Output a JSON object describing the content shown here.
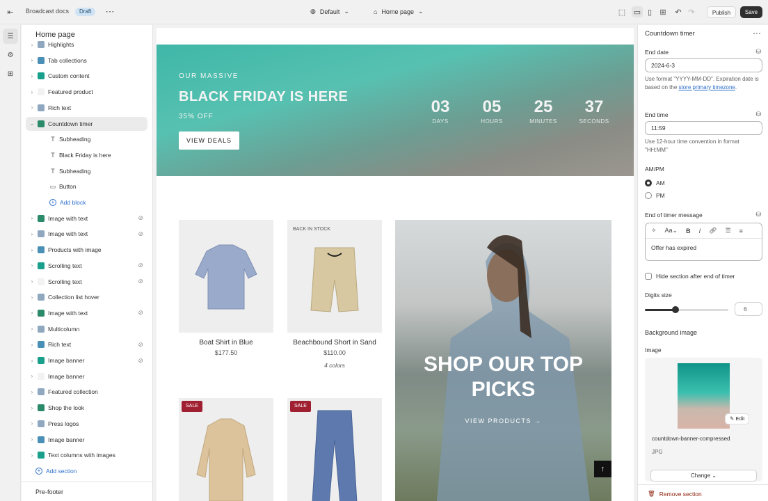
{
  "topbar": {
    "store_name": "Broadcast docs",
    "status_badge": "Draft",
    "theme_select": "Default",
    "page_select": "Home page",
    "publish_label": "Publish",
    "save_label": "Save"
  },
  "sidebar": {
    "title": "Home page",
    "items": [
      {
        "label": "Highlights",
        "level": 0,
        "icon": "section-icon"
      },
      {
        "label": "Tab collections",
        "level": 0,
        "icon": "section-icon"
      },
      {
        "label": "Custom content",
        "level": 0,
        "icon": "section-icon"
      },
      {
        "label": "Featured product",
        "level": 0,
        "icon": "section-icon"
      },
      {
        "label": "Rich text",
        "level": 0,
        "icon": "section-icon"
      },
      {
        "label": "Countdown timer",
        "level": 0,
        "icon": "section-icon"
      },
      {
        "label": "Subheading",
        "level": 1,
        "icon": "text-icon"
      },
      {
        "label": "Black Friday is here",
        "level": 1,
        "icon": "text-icon"
      },
      {
        "label": "Subheading",
        "level": 1,
        "icon": "text-icon"
      },
      {
        "label": "Button",
        "level": 1,
        "icon": "button-icon"
      },
      {
        "label": "Add block",
        "level": 1,
        "icon": "add-icon"
      },
      {
        "label": "Image with text",
        "level": 0,
        "icon": "section-icon"
      },
      {
        "label": "Image with text",
        "level": 0,
        "icon": "section-icon"
      },
      {
        "label": "Products with image",
        "level": 0,
        "icon": "section-icon"
      },
      {
        "label": "Scrolling text",
        "level": 0,
        "icon": "section-icon"
      },
      {
        "label": "Scrolling text",
        "level": 0,
        "icon": "section-icon"
      },
      {
        "label": "Collection list hover",
        "level": 0,
        "icon": "section-icon"
      },
      {
        "label": "Image with text",
        "level": 0,
        "icon": "section-icon"
      },
      {
        "label": "Multicolumn",
        "level": 0,
        "icon": "section-icon"
      },
      {
        "label": "Rich text",
        "level": 0,
        "icon": "section-icon"
      },
      {
        "label": "Image banner",
        "level": 0,
        "icon": "section-icon"
      },
      {
        "label": "Image banner",
        "level": 0,
        "icon": "section-icon"
      },
      {
        "label": "Featured collection",
        "level": 0,
        "icon": "section-icon"
      },
      {
        "label": "Shop the look",
        "level": 0,
        "icon": "section-icon"
      },
      {
        "label": "Press logos",
        "level": 0,
        "icon": "section-icon"
      },
      {
        "label": "Image banner",
        "level": 0,
        "icon": "section-icon"
      },
      {
        "label": "Text columns with images",
        "level": 0,
        "icon": "section-icon"
      },
      {
        "label": "Add section",
        "level": 0,
        "icon": "add-icon"
      }
    ],
    "footer_group": "Pre-footer"
  },
  "preview": {
    "hero": {
      "subheading": "OUR MASSIVE",
      "heading": "BLACK FRIDAY IS HERE",
      "discount": "35% OFF",
      "button": "VIEW DEALS",
      "countdown": [
        {
          "value": "03",
          "label": "DAYS"
        },
        {
          "value": "05",
          "label": "HOURS"
        },
        {
          "value": "25",
          "label": "MINUTES"
        },
        {
          "value": "37",
          "label": "SECONDS"
        }
      ]
    },
    "products": [
      {
        "name": "Boat Shirt in Blue",
        "price": "$177.50",
        "badge": "",
        "colors": ""
      },
      {
        "name": "Beachbound Short in Sand",
        "price": "$110.00",
        "badge": "BACK IN STOCK",
        "colors": "4 colors"
      },
      {
        "name": "",
        "price": "",
        "badge": "SALE",
        "colors": ""
      },
      {
        "name": "",
        "price": "",
        "badge": "SALE",
        "colors": ""
      }
    ],
    "feature": {
      "title": "SHOP OUR TOP PICKS",
      "link": "VIEW PRODUCTS"
    }
  },
  "settings": {
    "title": "Countdown timer",
    "end_date_label": "End date",
    "end_date_value": "2024-6-3",
    "end_date_help": "Use format \"YYYY-MM-DD\". Expiration date is based on the",
    "end_date_link": "store primary timezone",
    "end_time_label": "End time",
    "end_time_value": "11:59",
    "end_time_help": "Use 12-hour time convention in format \"HH:MM\"",
    "ampm_label": "AM/PM",
    "am_label": "AM",
    "pm_label": "PM",
    "ampm_selected": "AM",
    "end_message_label": "End of timer message",
    "end_message_value": "Offer has expired",
    "hide_section_label": "Hide section after end of timer",
    "digits_size_label": "Digits size",
    "digits_size_value": "6",
    "digits_size_fraction": 0.37,
    "bg_image_heading": "Background image",
    "image_label": "Image",
    "image_filename": "countdown-banner-compressed",
    "image_type": "JPG",
    "edit_label": "Edit",
    "change_label": "Change",
    "remove_label": "Remove section"
  },
  "colors": {
    "accent_link": "#2c6ecb",
    "sale_badge": "#a02031",
    "save_button": "#303030",
    "remove_text": "#8e1f0b"
  }
}
